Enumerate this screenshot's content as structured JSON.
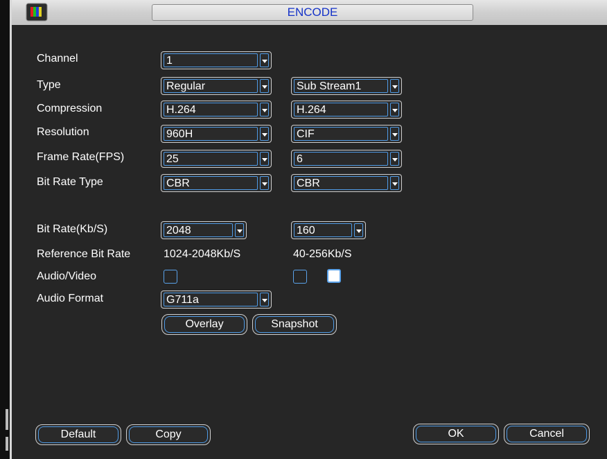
{
  "window": {
    "title": "ENCODE",
    "icon": "color-bars-app-icon"
  },
  "labels": {
    "channel": "Channel",
    "type": "Type",
    "compression": "Compression",
    "resolution": "Resolution",
    "frame_rate": "Frame Rate(FPS)",
    "bit_rate_type": "Bit Rate Type",
    "bit_rate": "Bit Rate(Kb/S)",
    "reference_bit_rate": "Reference Bit Rate",
    "audio_video": "Audio/Video",
    "audio_format": "Audio Format"
  },
  "main_stream": {
    "channel": "1",
    "type": "Regular",
    "compression": "H.264",
    "resolution": "960H",
    "frame_rate": "25",
    "bit_rate_type": "CBR",
    "bit_rate": "2048",
    "reference_bit_rate": "1024-2048Kb/S",
    "audio_video_checked": false,
    "audio_format": "G711a"
  },
  "sub_stream": {
    "type": "Sub Stream1",
    "compression": "H.264",
    "resolution": "CIF",
    "frame_rate": "6",
    "bit_rate_type": "CBR",
    "bit_rate": "160",
    "reference_bit_rate": "40-256Kb/S",
    "video_checked": false,
    "audio_checked": true
  },
  "buttons": {
    "overlay": "Overlay",
    "snapshot": "Snapshot",
    "default": "Default",
    "copy": "Copy",
    "ok": "OK",
    "cancel": "Cancel"
  },
  "colors": {
    "title_text": "#1533c8",
    "control_border": "#4f9be6",
    "panel_bg": "#262626"
  }
}
